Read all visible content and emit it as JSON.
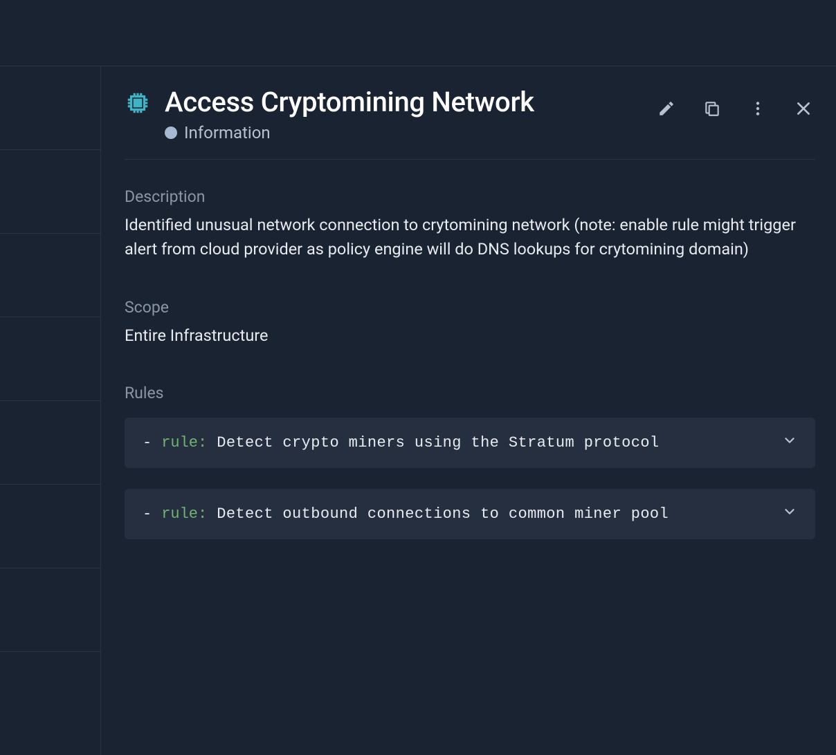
{
  "header": {
    "title": "Access Cryptomining Network",
    "severity": "Information"
  },
  "description": {
    "label": "Description",
    "text": "Identified unusual network connection to crytomining network (note: enable rule might trigger alert from cloud provider as policy engine will do DNS lookups for crytomining domain)"
  },
  "scope": {
    "label": "Scope",
    "text": "Entire Infrastructure"
  },
  "rules": {
    "label": "Rules",
    "items": [
      {
        "keyword": "rule:",
        "text": "Detect crypto miners using the Stratum protocol"
      },
      {
        "keyword": "rule:",
        "text": "Detect outbound connections to common miner pool"
      }
    ]
  }
}
